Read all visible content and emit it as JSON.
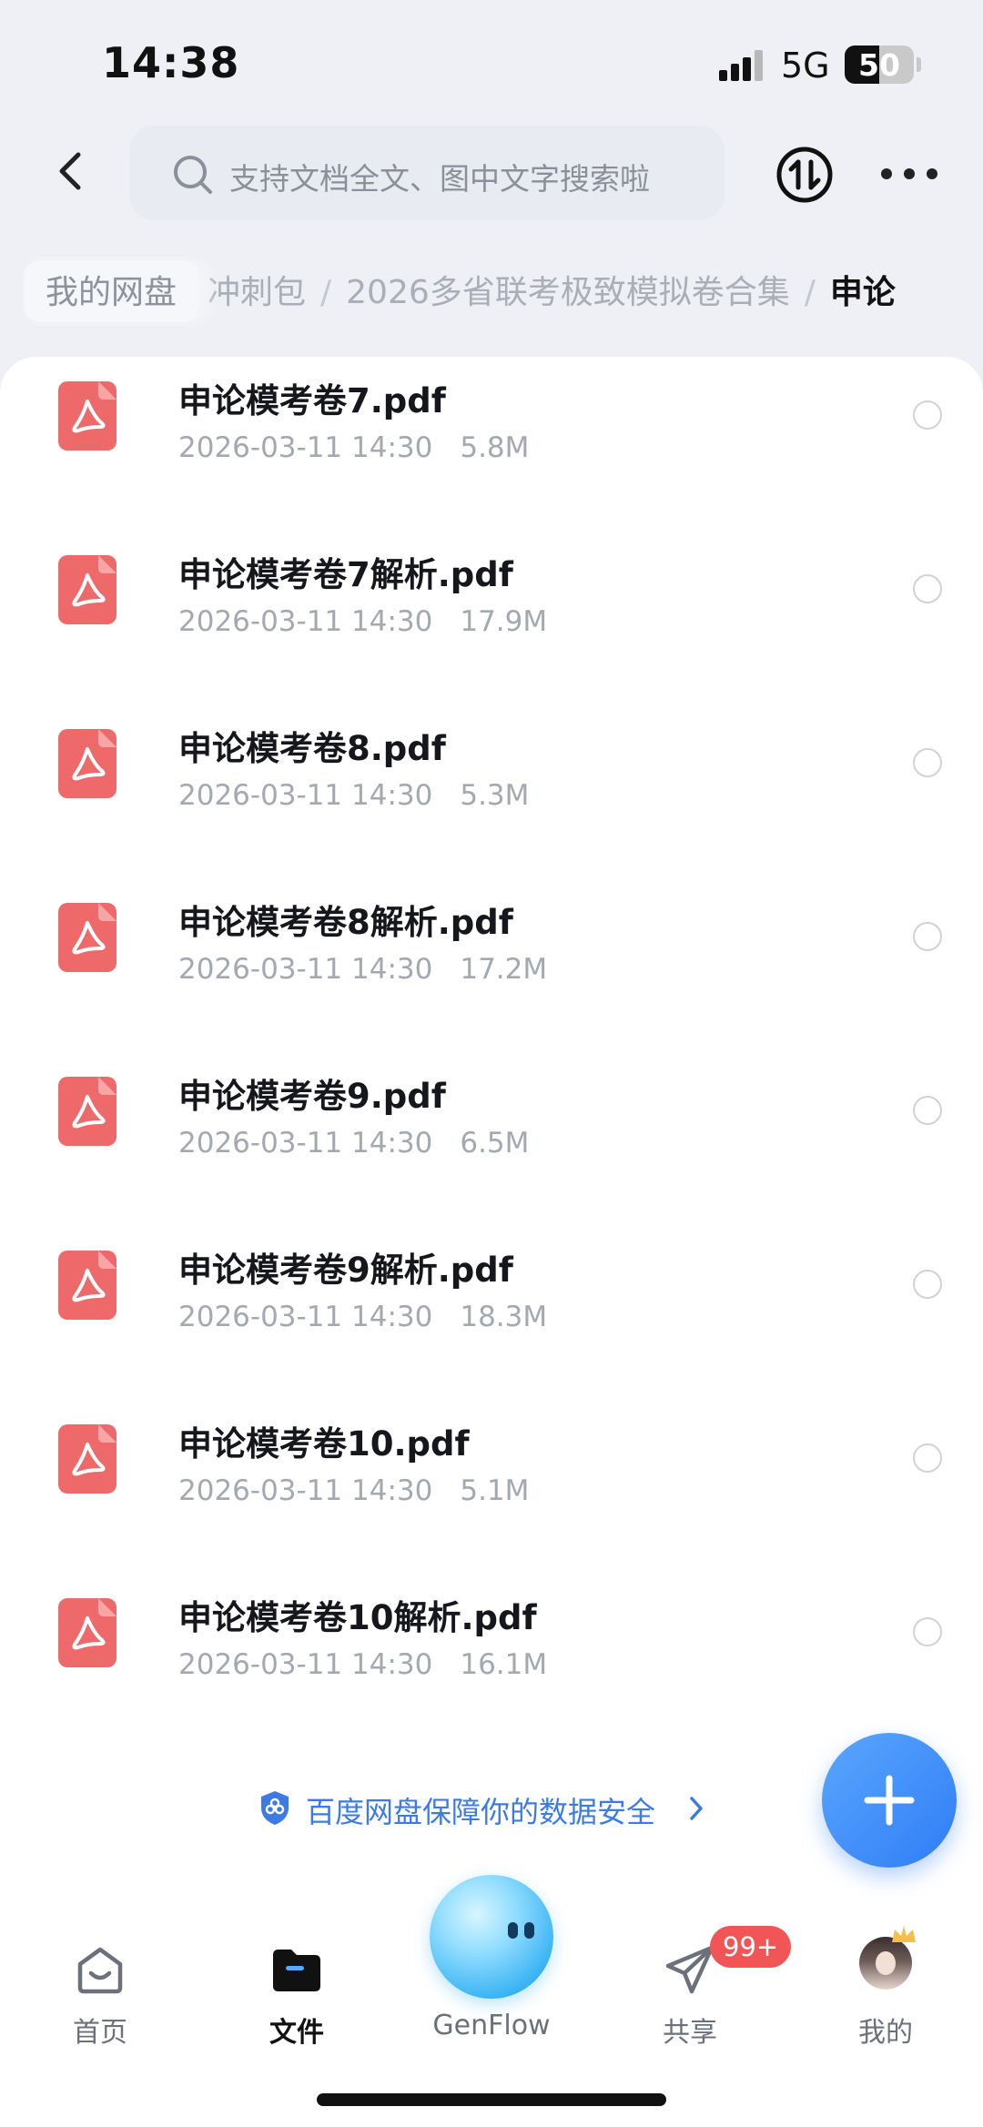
{
  "status_bar": {
    "time": "14:38",
    "network": "5G",
    "battery": "50",
    "battery_level": 0.5
  },
  "header": {
    "search_placeholder": "支持文档全文、图中文字搜索啦"
  },
  "breadcrumb": {
    "root": "我的网盘",
    "items": [
      "冲刺包",
      "2026多省联考极致模拟卷合集",
      "申论"
    ],
    "separator": "/"
  },
  "files": [
    {
      "name": "申论模考卷7.pdf",
      "date": "2026-03-11 14:30",
      "size": "5.8M"
    },
    {
      "name": "申论模考卷7解析.pdf",
      "date": "2026-03-11 14:30",
      "size": "17.9M"
    },
    {
      "name": "申论模考卷8.pdf",
      "date": "2026-03-11 14:30",
      "size": "5.3M"
    },
    {
      "name": "申论模考卷8解析.pdf",
      "date": "2026-03-11 14:30",
      "size": "17.2M"
    },
    {
      "name": "申论模考卷9.pdf",
      "date": "2026-03-11 14:30",
      "size": "6.5M"
    },
    {
      "name": "申论模考卷9解析.pdf",
      "date": "2026-03-11 14:30",
      "size": "18.3M"
    },
    {
      "name": "申论模考卷10.pdf",
      "date": "2026-03-11 14:30",
      "size": "5.1M"
    },
    {
      "name": "申论模考卷10解析.pdf",
      "date": "2026-03-11 14:30",
      "size": "16.1M"
    }
  ],
  "security_note": "百度网盘保障你的数据安全",
  "nav": {
    "home": "首页",
    "files": "文件",
    "genflow": "GenFlow",
    "share": "共享",
    "share_badge": "99+",
    "me": "我的"
  },
  "colors": {
    "accent": "#3c7be6",
    "pdf_icon": "#ee6a6a",
    "badge": "#f25555"
  },
  "icons": [
    "back-icon",
    "search-icon",
    "sort-icon",
    "more-icon",
    "pdf-icon",
    "shield-icon",
    "plus-icon",
    "home-icon",
    "folder-icon",
    "share-icon"
  ]
}
